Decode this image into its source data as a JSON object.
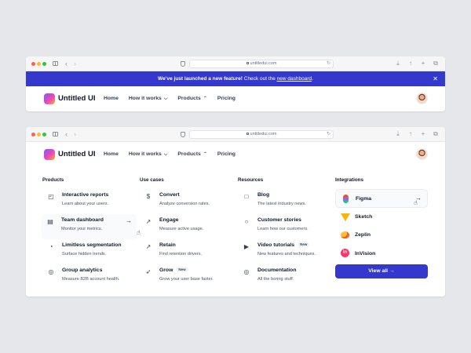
{
  "browser": {
    "url": "untitledui.com",
    "back_icon": "‹",
    "forward_icon": "›",
    "reload_icon": "↻",
    "toolbar_icons": [
      "download-icon",
      "share-icon",
      "new-tab-icon",
      "tabs-icon"
    ],
    "toolbar_glyphs": [
      "⤓",
      "↑",
      "+",
      "⧉"
    ]
  },
  "banner": {
    "strong": "We’ve just launched a new feature!",
    "text": "Check out the",
    "link": "new dashboard",
    "end": ".",
    "close": "✕",
    "color": "#3538CD"
  },
  "brand": {
    "name": "Untitled UI"
  },
  "nav": {
    "home": "Home",
    "how_it_works": "How it works",
    "products": "Products",
    "pricing": "Pricing",
    "caret_down": "⌵",
    "caret_up": "⌃"
  },
  "menu": {
    "products": {
      "title": "Products",
      "items": [
        {
          "title": "Interactive reports",
          "desc": "Learn about your users.",
          "icon": "chart-icon",
          "glyph": "◰"
        },
        {
          "title": "Team dashboard",
          "desc": "Monitor your metrics.",
          "icon": "dashboard-icon",
          "glyph": "▤"
        },
        {
          "title": "Limitless segmentation",
          "desc": "Surface hidden trends.",
          "icon": "pie-chart-icon",
          "glyph": "◔"
        },
        {
          "title": "Group analytics",
          "desc": "Measure B2B account health.",
          "icon": "group-icon",
          "glyph": "◎"
        }
      ]
    },
    "use_cases": {
      "title": "Use cases",
      "items": [
        {
          "title": "Convert",
          "desc": "Analyze conversion rates.",
          "icon": "dollar-icon",
          "glyph": "$"
        },
        {
          "title": "Engage",
          "desc": "Measure active usage.",
          "icon": "click-icon",
          "glyph": "↗"
        },
        {
          "title": "Retain",
          "desc": "Find retention drivers.",
          "icon": "trend-icon",
          "glyph": "↗"
        },
        {
          "title": "Grow",
          "desc": "Grow your user base faster.",
          "icon": "rocket-icon",
          "glyph": "➶",
          "badge": "New"
        }
      ]
    },
    "resources": {
      "title": "Resources",
      "items": [
        {
          "title": "Blog",
          "desc": "The latest industry news.",
          "icon": "book-icon",
          "glyph": "□"
        },
        {
          "title": "Customer stories",
          "desc": "Learn how our customers.",
          "icon": "message-icon",
          "glyph": "○"
        },
        {
          "title": "Video tutorials",
          "desc": "New features and techniques.",
          "icon": "play-icon",
          "glyph": "▶",
          "badge": "New"
        },
        {
          "title": "Documentation",
          "desc": "All the boring stuff.",
          "icon": "life-buoy-icon",
          "glyph": "◎"
        }
      ]
    },
    "integrations": {
      "title": "Integrations",
      "items": [
        {
          "label": "Figma",
          "icon": "figma-icon"
        },
        {
          "label": "Sketch",
          "icon": "sketch-icon"
        },
        {
          "label": "Zeplin",
          "icon": "zeplin-icon"
        },
        {
          "label": "InVision",
          "icon": "invision-icon",
          "glyph": "in"
        }
      ],
      "view_all": "View all",
      "arrow": "→"
    }
  },
  "pointer": "☝"
}
